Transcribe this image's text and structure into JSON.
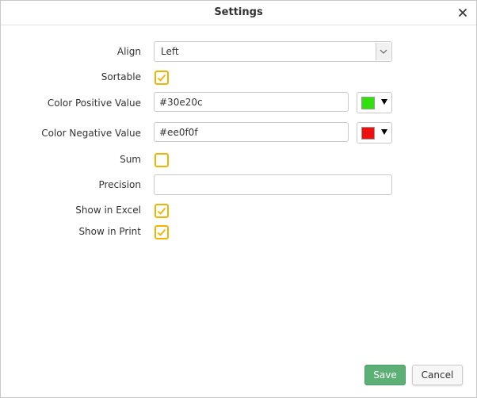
{
  "dialog": {
    "title": "Settings"
  },
  "fields": {
    "align": {
      "label": "Align",
      "value": "Left"
    },
    "sortable": {
      "label": "Sortable",
      "checked": true
    },
    "color_positive": {
      "label": "Color Positive Value",
      "value": "#30e20c",
      "swatch": "#30e20c"
    },
    "color_negative": {
      "label": "Color Negative Value",
      "value": "#ee0f0f",
      "swatch": "#ee0f0f"
    },
    "sum": {
      "label": "Sum",
      "checked": false
    },
    "precision": {
      "label": "Precision",
      "value": ""
    },
    "show_in_excel": {
      "label": "Show in Excel",
      "checked": true
    },
    "show_in_print": {
      "label": "Show in Print",
      "checked": true
    }
  },
  "buttons": {
    "save": "Save",
    "cancel": "Cancel"
  },
  "colors": {
    "accent_checkbox": "#f0b400",
    "save_button": "#5cb076"
  }
}
